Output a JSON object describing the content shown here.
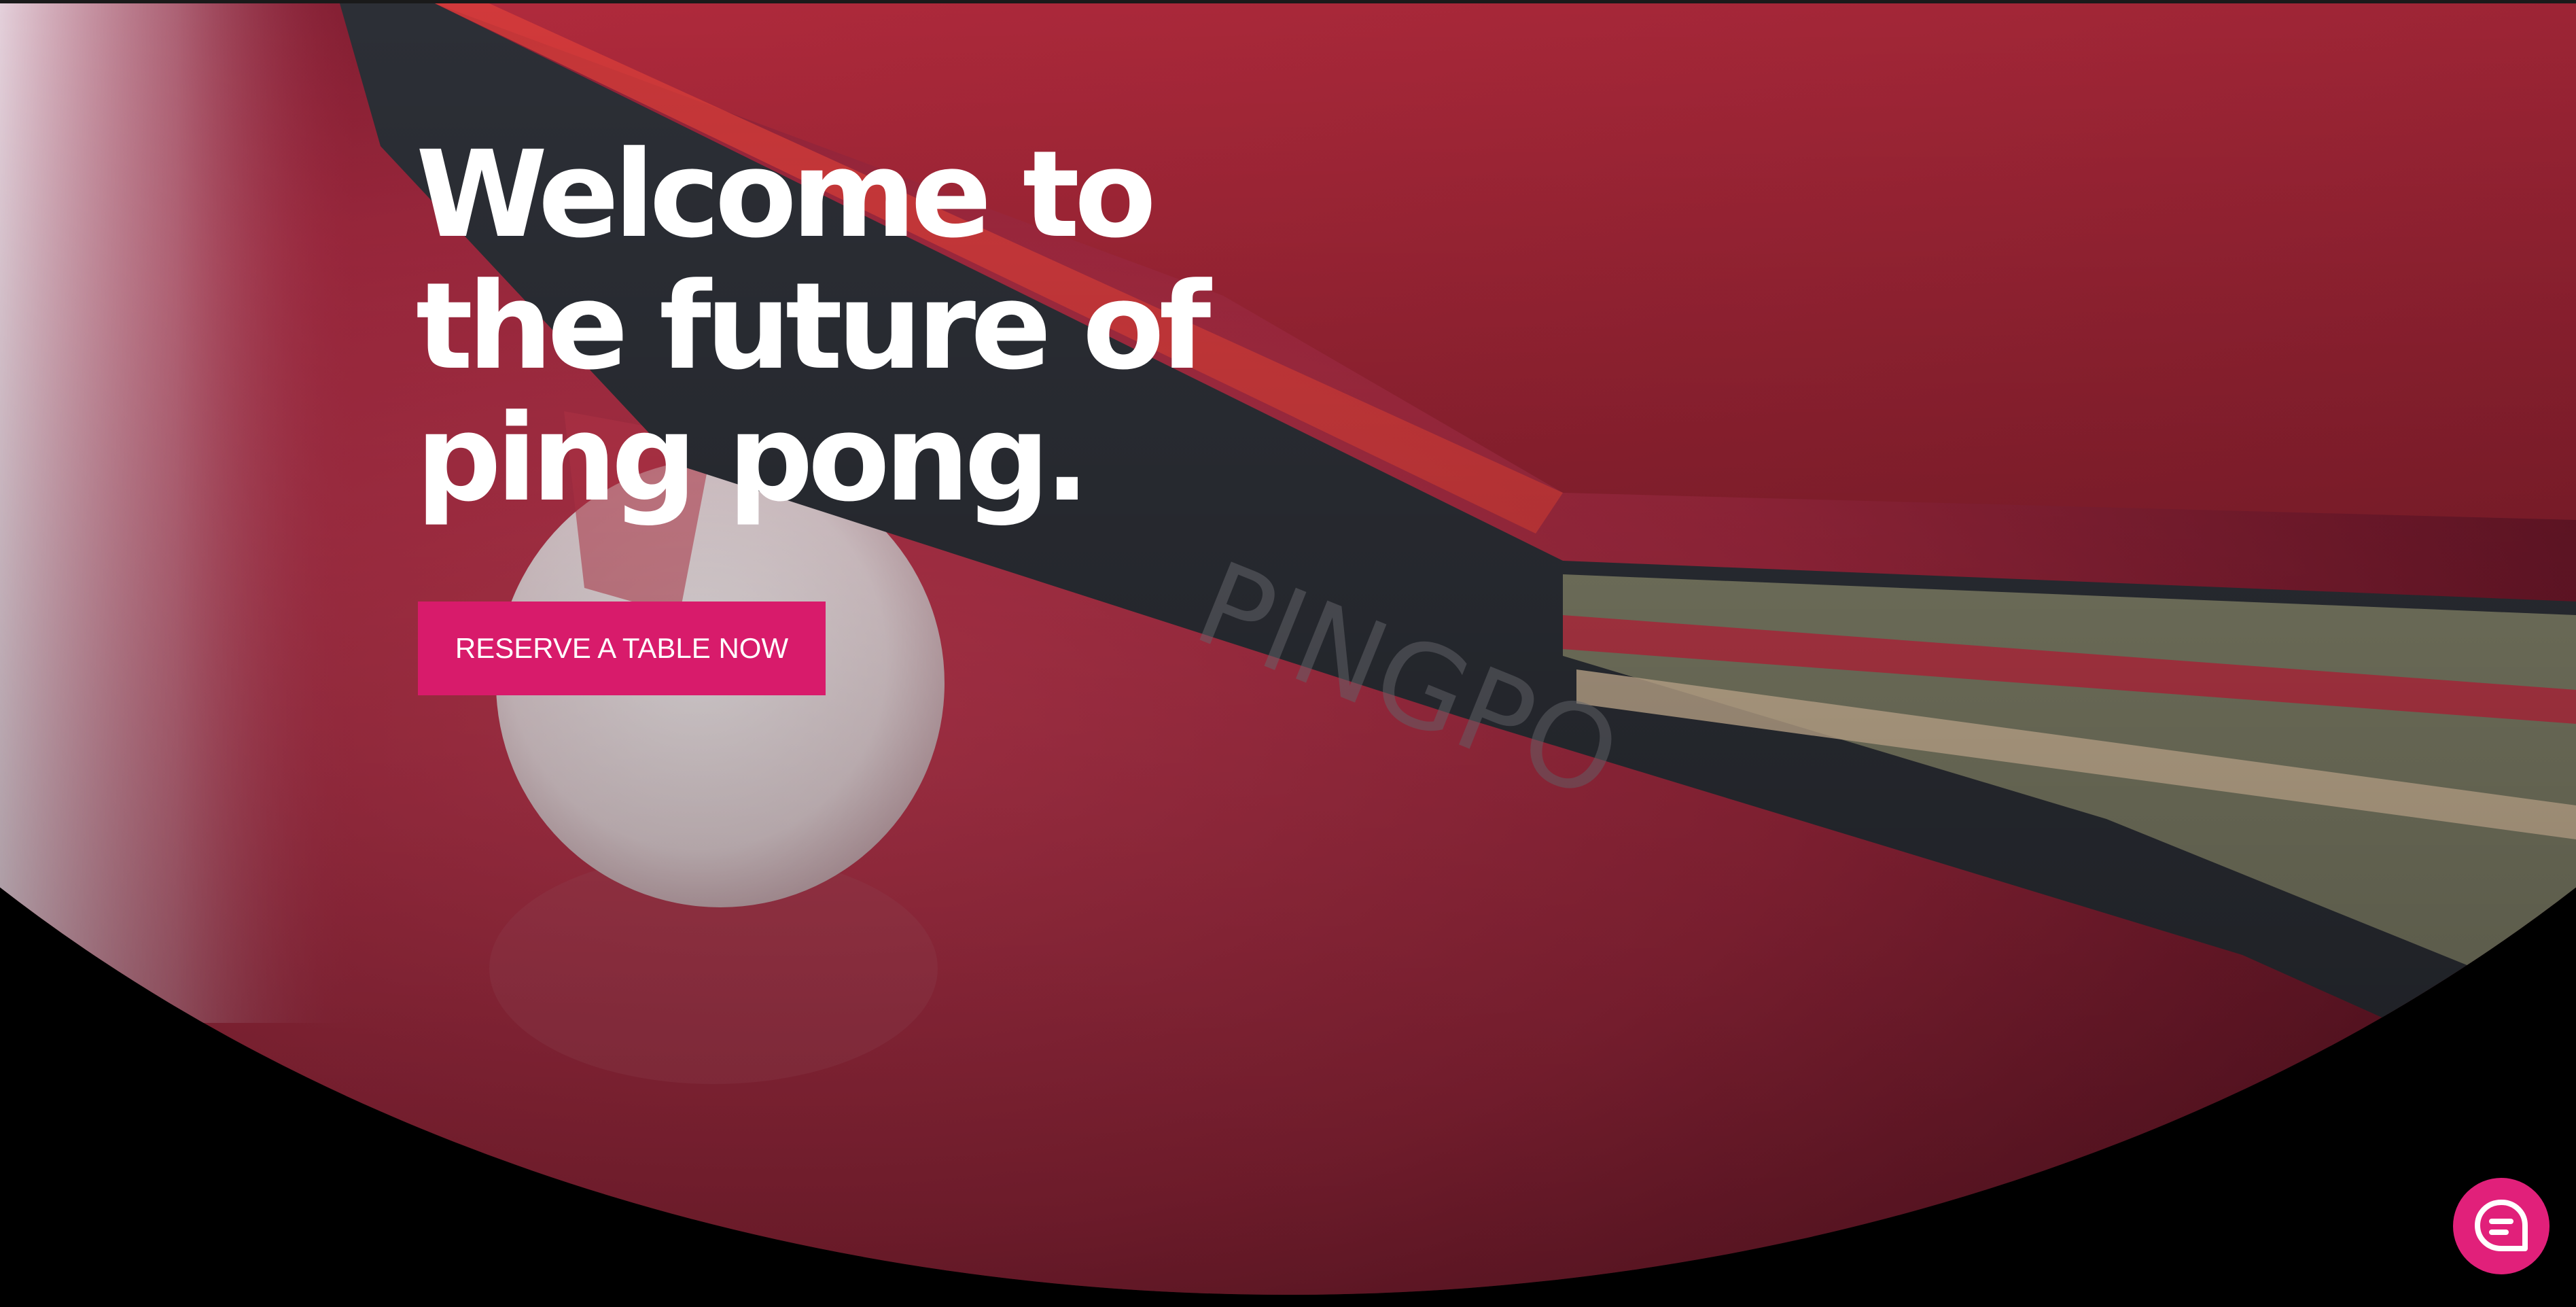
{
  "hero": {
    "headline_line1": "Welcome to",
    "headline_line2": "the future of",
    "headline_line3": "ping pong.",
    "cta_label": "RESERVE A TABLE NOW",
    "background_image": "ping-pong-paddle-and-ball-photo"
  },
  "chat": {
    "icon": "chat-bubble-icon"
  },
  "colors": {
    "accent": "#d81b6b",
    "chat_button": "#e1207a",
    "text": "#ffffff",
    "background": "#000000"
  }
}
